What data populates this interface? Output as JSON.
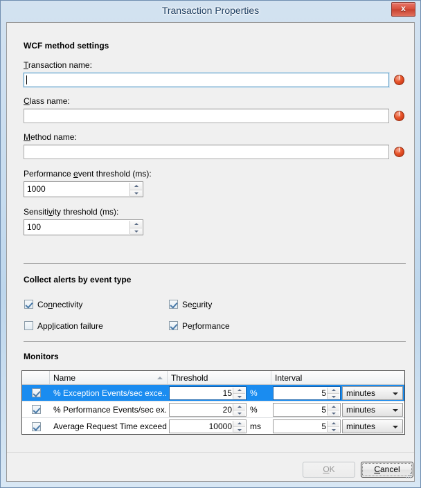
{
  "window": {
    "title": "Transaction Properties",
    "close_label": "x",
    "close_icon": "close-icon"
  },
  "sections": {
    "wcf": {
      "heading": "WCF method settings",
      "fields": [
        {
          "label_pre": "T",
          "label_post": "ransaction name:",
          "value": "",
          "focused": true,
          "error": true
        },
        {
          "label_pre": "C",
          "label_post": "lass name:",
          "value": "",
          "focused": false,
          "error": true
        },
        {
          "label_pre": "M",
          "label_post": "ethod name:",
          "value": "",
          "focused": false,
          "error": true
        }
      ],
      "spinners": [
        {
          "label_a": "Performance ",
          "label_u": "e",
          "label_b": "vent threshold (ms):",
          "value": "1000"
        },
        {
          "label_a": "Sensiti",
          "label_u": "v",
          "label_b": "ity threshold (ms):",
          "value": "100"
        }
      ]
    },
    "alerts": {
      "heading": "Collect alerts by event type",
      "items": [
        {
          "pre": "Co",
          "u": "n",
          "post": "nectivity",
          "checked": true
        },
        {
          "pre": "Se",
          "u": "c",
          "post": "urity",
          "checked": true
        },
        {
          "pre": "App",
          "u": "l",
          "post": "ication failure",
          "checked": false
        },
        {
          "pre": "Pe",
          "u": "r",
          "post": "formance",
          "checked": true
        }
      ]
    },
    "monitors": {
      "heading": "Monitors",
      "columns": [
        "",
        "Name",
        "Threshold",
        "Interval"
      ],
      "sort_column": "Name",
      "sort_direction": "ascending",
      "rows": [
        {
          "checked": true,
          "name": "% Exception Events/sec exce...",
          "threshold": "15",
          "threshold_unit": "%",
          "interval": "5",
          "interval_unit": "minutes",
          "selected": true
        },
        {
          "checked": true,
          "name": "% Performance Events/sec ex...",
          "threshold": "20",
          "threshold_unit": "%",
          "interval": "5",
          "interval_unit": "minutes",
          "selected": false
        },
        {
          "checked": true,
          "name": "Average Request Time exceed...",
          "threshold": "10000",
          "threshold_unit": "ms",
          "interval": "5",
          "interval_unit": "minutes",
          "selected": false
        }
      ]
    }
  },
  "footer": {
    "ok": {
      "pre": "",
      "u": "O",
      "post": "K",
      "enabled": false
    },
    "cancel": {
      "pre": "",
      "u": "C",
      "post": "ancel",
      "enabled": true,
      "default": true
    }
  },
  "colors": {
    "selection": "#1a8cf0",
    "error": "#c02f10",
    "title_text": "#1d3f63",
    "close_button": "#d9523f"
  }
}
